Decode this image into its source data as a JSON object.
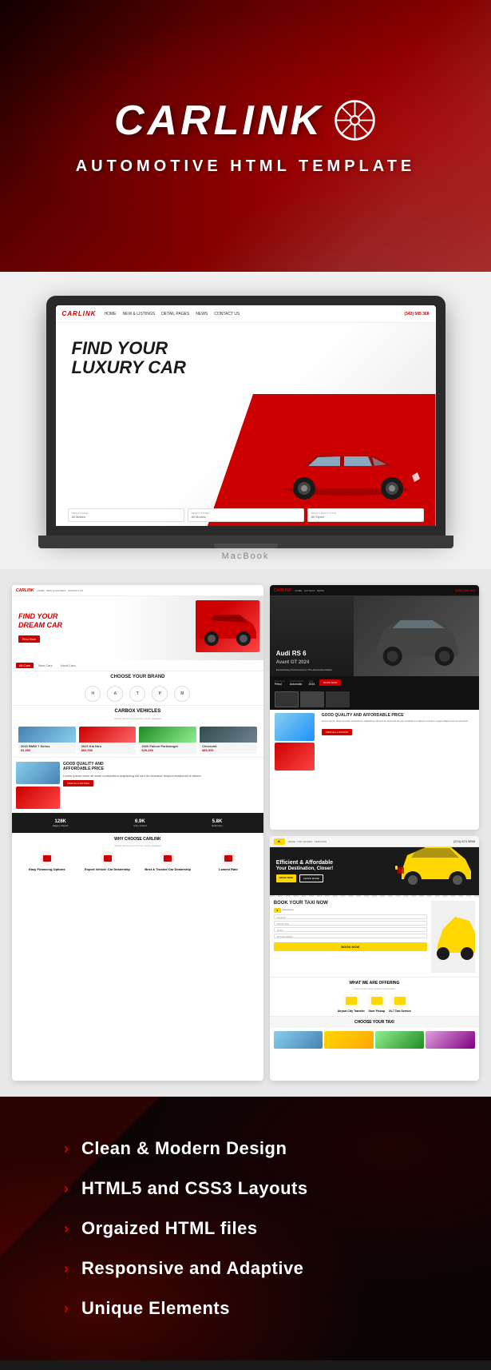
{
  "hero": {
    "brand_name": "CARLINK",
    "subtitle": "AUTOMOTIVE  HTML TEMPLATE",
    "laptop_label": "MacBook"
  },
  "laptop_screen": {
    "logo": "CARLINK",
    "nav_links": [
      "HOME",
      "NEW & LISTINGS",
      "DETAIL PAGES",
      "NEWS",
      "CONTACT US"
    ],
    "phone": "(342) 585 368",
    "hero_title_line1": "Find Your",
    "hero_title_line2": "Luxury Car",
    "filter1_label": "SELECT MAKE",
    "filter1_value": "All Makes",
    "filter2_label": "SELECT MODEL",
    "filter2_value": "All Models",
    "filter3_label": "SELECT BODY STYLE",
    "filter3_value": "All Styles"
  },
  "screenshots": {
    "left_screen": {
      "logo": "CARLINK",
      "hero_title": "FIND YOUR\nDREAM CAR",
      "btn_label": "Find Now",
      "section_title": "CHOOSE YOUR BRAND",
      "brands": [
        "H",
        "A",
        "T",
        "P",
        "M"
      ],
      "cars_title": "CARBOX VEHICLES",
      "stats": [
        "128K",
        "6.9K",
        "5.8K"
      ],
      "why_title": "WHY CHOOSE CARLINK"
    },
    "right_top": {
      "logo": "CARLINK",
      "nav_links": [
        "HOME",
        "NEW & LISTINGS",
        "DETAIL PAGES",
        "NEWS",
        "CONTACT US"
      ],
      "phone": "(342) 585 368",
      "car_title": "Audi RS 6",
      "car_subtitle": "Avant GT 2024",
      "quality_title": "GOOD QUALITY AND\nAFFORDABLE PRICE"
    },
    "right_bottom": {
      "taxi_logo": "K",
      "hero_title": "Efficient & Affordable\nYour Destination, Closer!",
      "book_title": "BOOK YOUR TAXI NOW",
      "book_fields": [
        "PICKUP",
        "DROP OFF",
        "DATE",
        "PASSENGERS"
      ],
      "book_btn": "BOOK NOW",
      "offering_title": "WHAT WE ARE OFFERING",
      "choose_title": "CHOOSE YOUR TAXI"
    }
  },
  "features": {
    "items": [
      {
        "label": "Clean & Modern Design",
        "arrow": ">"
      },
      {
        "label": "HTML5 and CSS3 Layouts",
        "arrow": ">"
      },
      {
        "label": "Orgaized HTML files",
        "arrow": ">"
      },
      {
        "label": "Responsive and Adaptive",
        "arrow": ">"
      },
      {
        "label": "Unique Elements",
        "arrow": ">"
      }
    ]
  }
}
